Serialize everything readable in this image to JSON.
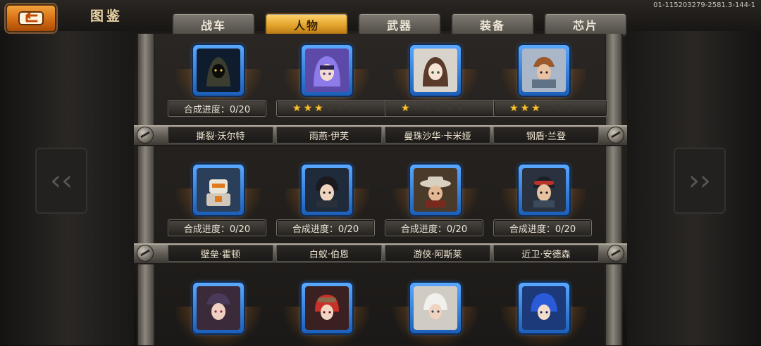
{
  "header": {
    "title": "图鉴",
    "build_id": "01-115203279-2581.3-144-1",
    "back_icon": "return-arrow-icon"
  },
  "tabs": [
    {
      "label": "战车",
      "active": false
    },
    {
      "label": "人物",
      "active": true
    },
    {
      "label": "武器",
      "active": false
    },
    {
      "label": "装备",
      "active": false
    },
    {
      "label": "芯片",
      "active": false
    }
  ],
  "rows": [
    {
      "cards": [
        {
          "name": "撕裂·沃尔特",
          "status": "合成进度：0/20",
          "portrait": "hooded-figure-icon"
        },
        {
          "name": "雨燕·伊芙",
          "stars": 3,
          "max_stars": 6,
          "portrait": "purple-hair-girl-icon"
        },
        {
          "name": "曼珠沙华·卡米娅",
          "stars": 1,
          "max_stars": 6,
          "portrait": "brown-hair-girl-icon"
        },
        {
          "name": "钢盾·兰登",
          "stars": 3,
          "max_stars": 6,
          "portrait": "armored-soldier-icon"
        }
      ]
    },
    {
      "cards": [
        {
          "name": "壁垒·霍顿",
          "status": "合成进度：0/20",
          "portrait": "mech-robot-icon"
        },
        {
          "name": "白蚁·伯恩",
          "status": "合成进度：0/20",
          "portrait": "dark-hair-boy-icon"
        },
        {
          "name": "游侠·阿斯莱",
          "status": "合成进度：0/20",
          "portrait": "cowboy-hat-icon"
        },
        {
          "name": "近卫·安德森",
          "status": "合成进度：0/20",
          "portrait": "goggles-soldier-icon"
        }
      ]
    },
    {
      "cards": [
        {
          "portrait": "cap-girl-icon"
        },
        {
          "portrait": "red-hair-pilot-icon"
        },
        {
          "portrait": "white-hair-boy-icon"
        },
        {
          "portrait": "blue-hair-boy-icon"
        }
      ]
    }
  ],
  "colors": {
    "accent": "#e1a22a",
    "portrait_frame": "#1c5fb8",
    "star": "#f6c233"
  }
}
